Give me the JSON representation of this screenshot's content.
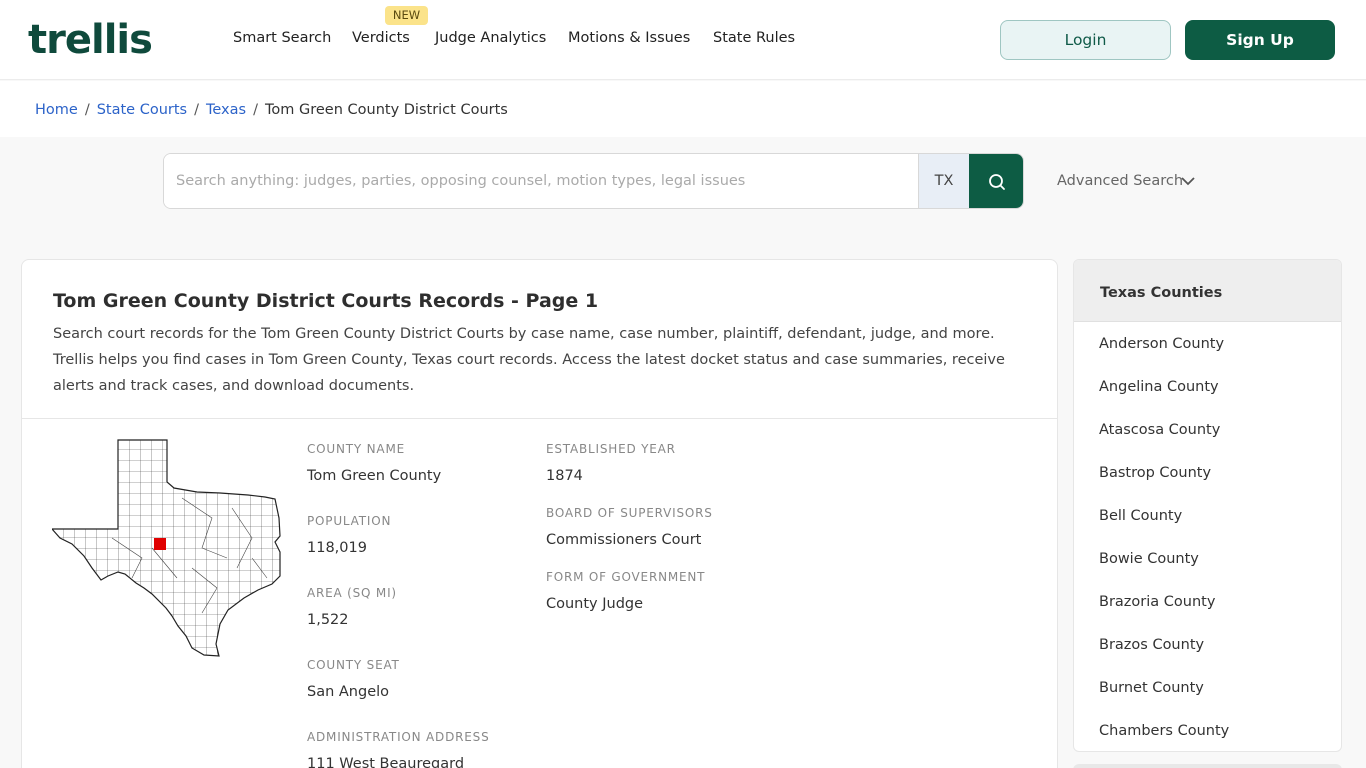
{
  "header": {
    "logo": "trellis",
    "nav": [
      "Smart Search",
      "Verdicts",
      "Judge Analytics",
      "Motions & Issues",
      "State Rules"
    ],
    "new_badge": "NEW",
    "login": "Login",
    "signup": "Sign Up"
  },
  "breadcrumb": {
    "items": [
      "Home",
      "State Courts",
      "Texas"
    ],
    "current": "Tom Green County District Courts"
  },
  "search": {
    "placeholder": "Search anything: judges, parties, opposing counsel, motion types, legal issues",
    "state": "TX",
    "advanced": "Advanced Search"
  },
  "main": {
    "title": "Tom Green County District Courts Records - Page 1",
    "description": "Search court records for the Tom Green County District Courts by case name, case number, plaintiff, defendant, judge, and more. Trellis helps you find cases in Tom Green County, Texas court records. Access the latest docket status and case summaries, receive alerts and track cases, and download documents.",
    "fields": {
      "county_name_label": "COUNTY NAME",
      "county_name": "Tom Green County",
      "population_label": "POPULATION",
      "population": "118,019",
      "area_label": "AREA (SQ MI)",
      "area": "1,522",
      "county_seat_label": "COUNTY SEAT",
      "county_seat": "San Angelo",
      "admin_address_label": "ADMINISTRATION ADDRESS",
      "admin_address": "111 West Beauregard",
      "established_label": "ESTABLISHED YEAR",
      "established": "1874",
      "board_label": "BOARD OF SUPERVISORS",
      "board": "Commissioners Court",
      "government_label": "FORM OF GOVERNMENT",
      "government": "County Judge"
    },
    "map_highlight_color": "#e00000"
  },
  "sidebar": {
    "title": "Texas Counties",
    "counties": [
      "Anderson County",
      "Angelina County",
      "Atascosa County",
      "Bastrop County",
      "Bell County",
      "Bowie County",
      "Brazoria County",
      "Brazos County",
      "Burnet County",
      "Chambers County"
    ]
  },
  "colors": {
    "brand": "#0d5c44",
    "link": "#2c63c9",
    "badge": "#fbe38a"
  }
}
